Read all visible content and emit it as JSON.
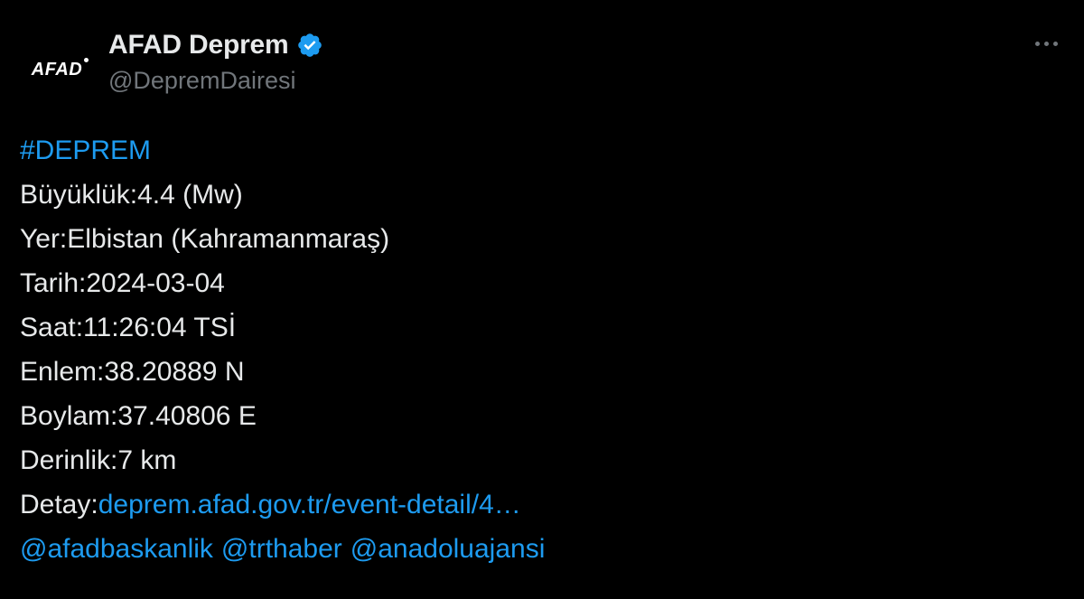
{
  "account": {
    "display_name": "AFAD Deprem",
    "handle": "@DepremDairesi",
    "avatar_logo_text": "AFAD",
    "verified": true
  },
  "colors": {
    "background": "#000000",
    "text": "#e7e9ea",
    "secondary": "#71767b",
    "link": "#1d9bf0",
    "verified_badge": "#1d9bf0"
  },
  "icons": {
    "verified": "verified-badge-icon",
    "more": "more-options-icon"
  },
  "tweet": {
    "hashtag": "#DEPREM",
    "magnitude": "Büyüklük:4.4 (Mw)",
    "location": "Yer:Elbistan (Kahramanmaraş)",
    "date": "Tarih:2024-03-04",
    "time": "Saat:11:26:04 TSİ",
    "latitude": "Enlem:38.20889 N",
    "longitude": "Boylam:37.40806 E",
    "depth": "Derinlik:7 km",
    "detail_label": "Detay:",
    "detail_link": "deprem.afad.gov.tr/event-detail/4…",
    "mentions": [
      "@afadbaskanlik",
      "@trthaber",
      "@anadoluajansi"
    ]
  }
}
